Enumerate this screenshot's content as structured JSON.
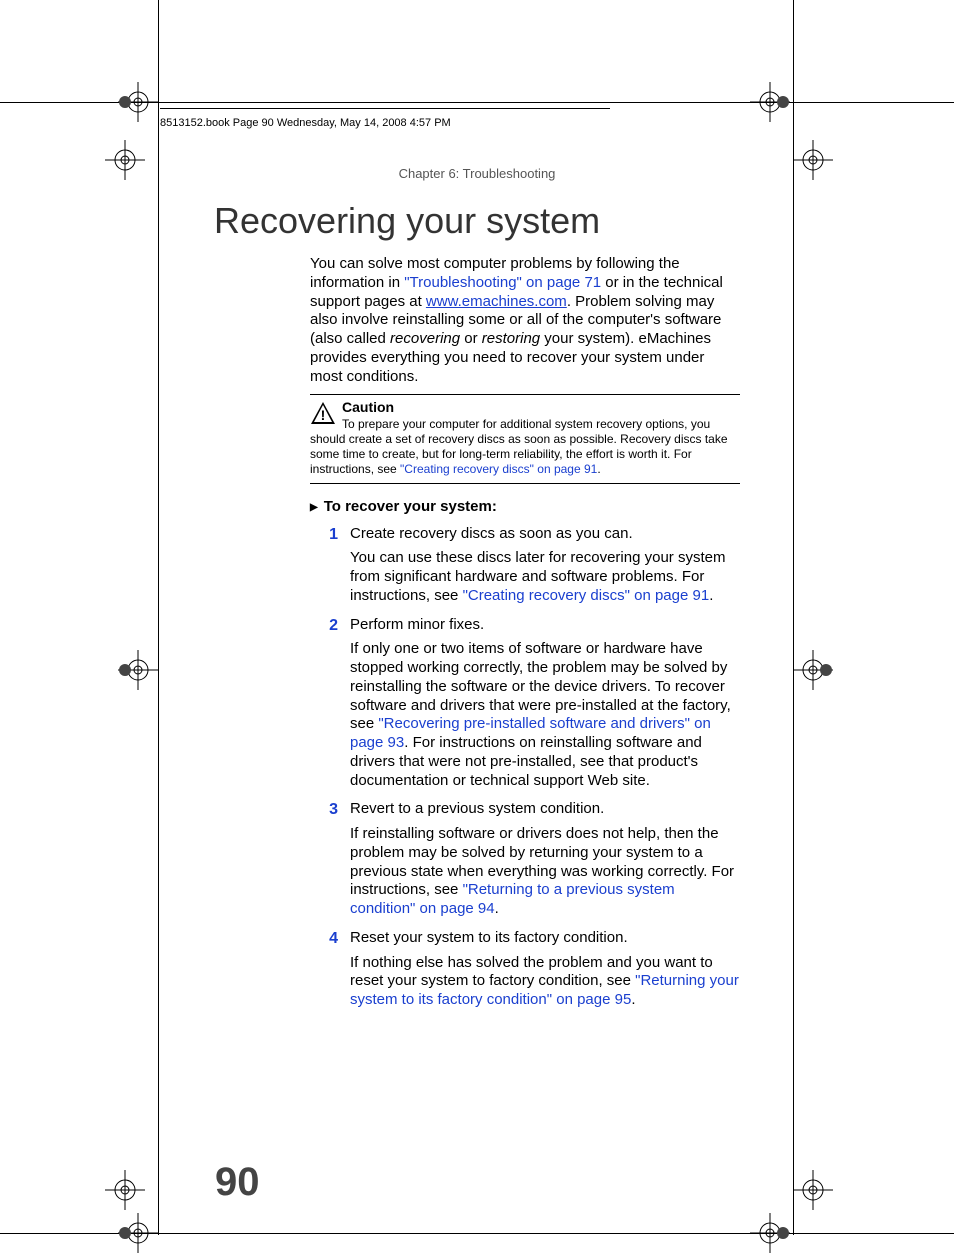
{
  "bookline": "8513152.book  Page 90  Wednesday, May 14, 2008  4:57 PM",
  "chapter_header": "Chapter 6: Troubleshooting",
  "title": "Recovering your system",
  "intro": {
    "part1": "You can solve most computer problems by following the information in ",
    "link1": "\"Troubleshooting\" on page 71",
    "part2": " or in the technical support pages at ",
    "link2": "www.emachines.com",
    "part3": ". Problem solving may also involve reinstalling some or all of the computer's software (also called ",
    "ital1": "recovering",
    "part4": " or ",
    "ital2": "restoring",
    "part5": " your system). eMachines provides everything you need to recover your system under most conditions."
  },
  "caution": {
    "heading": "Caution",
    "body1": "To prepare your computer for additional system recovery options, you should create a set of recovery discs as soon as possible. Recovery discs take some time to create, but for long-term reliability, the effort is worth it. For instructions, see ",
    "link": "\"Creating recovery discs\" on page 91",
    "body2": "."
  },
  "steps_heading": "To recover your system:",
  "steps": [
    {
      "num": "1",
      "lead": "Create recovery discs as soon as you can.",
      "detail1": "You can use these discs later for recovering your system from significant hardware and software problems. For instructions, see ",
      "link": "\"Creating recovery discs\" on page 91",
      "detail2": "."
    },
    {
      "num": "2",
      "lead": "Perform minor fixes.",
      "detail1": "If only one or two items of software or hardware have stopped working correctly, the problem may be solved by reinstalling the software or the device drivers. To recover software and drivers that were pre-installed at the factory, see ",
      "link": "\"Recovering pre-installed software and drivers\" on page 93",
      "detail2": ". For instructions on reinstalling software and drivers that were not pre-installed, see that product's documentation or technical support Web site."
    },
    {
      "num": "3",
      "lead": "Revert to a previous system condition.",
      "detail1": "If reinstalling software or drivers does not help, then the problem may be solved by returning your system to a previous state when everything was working correctly. For instructions, see ",
      "link": "\"Returning to a previous system condition\" on page 94",
      "detail2": "."
    },
    {
      "num": "4",
      "lead": "Reset your system to its factory condition.",
      "detail1": "If nothing else has solved the problem and you want to reset your system to factory condition, see ",
      "link": "\"Returning your system to its factory condition\" on page 95",
      "detail2": "."
    }
  ],
  "page_number": "90"
}
